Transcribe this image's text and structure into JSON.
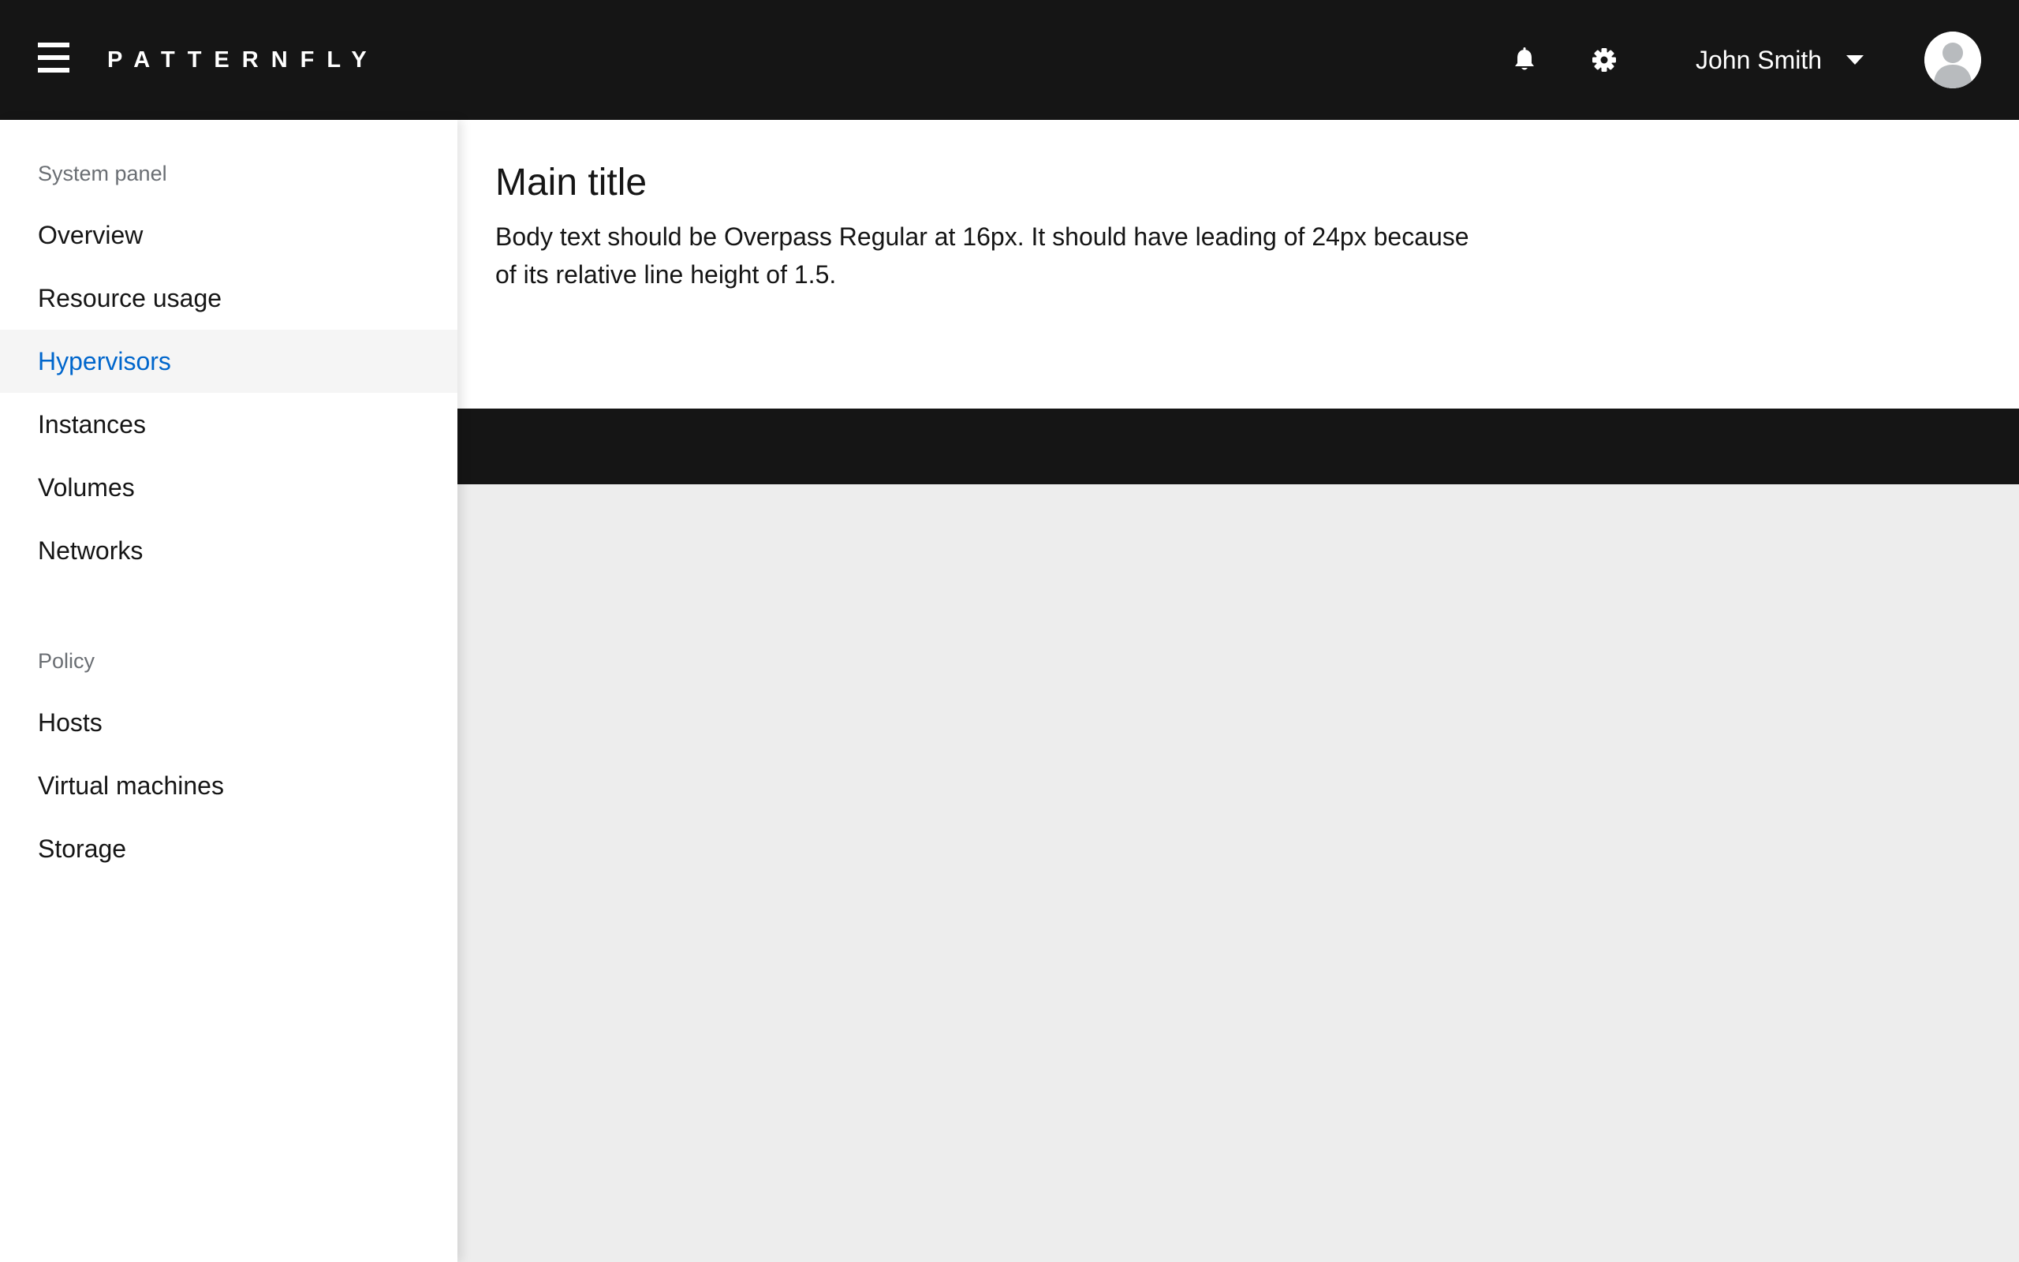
{
  "header": {
    "brand": "PATTERNFLY",
    "user_name": "John Smith",
    "icons": {
      "menu": "hamburger-menu-icon",
      "notifications": "bell-icon",
      "settings": "gear-icon",
      "user_caret": "caret-down-icon",
      "avatar": "user-avatar-icon"
    }
  },
  "sidebar": {
    "sections": [
      {
        "title": "System panel",
        "items": [
          {
            "label": "Overview"
          },
          {
            "label": "Resource usage"
          },
          {
            "label": "Hypervisors",
            "active": true
          },
          {
            "label": "Instances"
          },
          {
            "label": "Volumes"
          },
          {
            "label": "Networks"
          }
        ]
      },
      {
        "title": "Policy",
        "items": [
          {
            "label": "Hosts"
          },
          {
            "label": "Virtual machines"
          },
          {
            "label": "Storage"
          }
        ]
      }
    ]
  },
  "main": {
    "title": "Main title",
    "body": "Body text should be Overpass Regular at 16px. It should have leading of 24px because of its relative line height of 1.5."
  },
  "colors": {
    "masthead": "#151515",
    "active_link": "#0066cc",
    "active_bg": "#f5f5f5",
    "page_bg": "#ededed"
  }
}
